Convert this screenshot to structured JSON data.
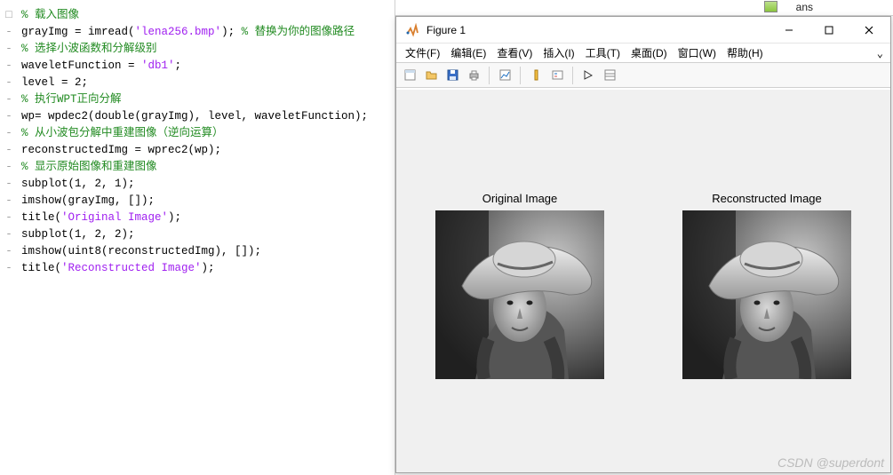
{
  "top_strip": {
    "box_label": "ans"
  },
  "code": {
    "lines": [
      {
        "dash": "□",
        "segs": [
          {
            "t": "% 载入图像",
            "c": "comment"
          }
        ]
      },
      {
        "dash": "-",
        "segs": [
          {
            "t": "grayImg = imread(",
            "c": "black"
          },
          {
            "t": "'lena256.bmp'",
            "c": "string"
          },
          {
            "t": "); ",
            "c": "black"
          },
          {
            "t": "% 替换为你的图像路径",
            "c": "comment"
          }
        ]
      },
      {
        "dash": "",
        "segs": []
      },
      {
        "dash": "",
        "segs": []
      },
      {
        "dash": "-",
        "segs": [
          {
            "t": "% 选择小波函数和分解级别",
            "c": "comment"
          }
        ]
      },
      {
        "dash": "-",
        "segs": [
          {
            "t": "waveletFunction = ",
            "c": "black"
          },
          {
            "t": "'db1'",
            "c": "string"
          },
          {
            "t": ";",
            "c": "black"
          }
        ]
      },
      {
        "dash": "-",
        "segs": [
          {
            "t": "level = 2;",
            "c": "black"
          }
        ]
      },
      {
        "dash": "",
        "segs": []
      },
      {
        "dash": "-",
        "segs": [
          {
            "t": "% 执行WPT正向分解",
            "c": "comment"
          }
        ]
      },
      {
        "dash": "-",
        "segs": [
          {
            "t": "wp= wpdec2(double(grayImg), level, waveletFunction);",
            "c": "black"
          }
        ]
      },
      {
        "dash": "",
        "segs": []
      },
      {
        "dash": "-",
        "segs": [
          {
            "t": "% 从小波包分解中重建图像（逆向运算）",
            "c": "comment"
          }
        ]
      },
      {
        "dash": "-",
        "segs": [
          {
            "t": "reconstructedImg = wprec2(wp);",
            "c": "black"
          }
        ]
      },
      {
        "dash": "",
        "segs": []
      },
      {
        "dash": "-",
        "segs": [
          {
            "t": "% 显示原始图像和重建图像",
            "c": "comment"
          }
        ]
      },
      {
        "dash": "-",
        "segs": [
          {
            "t": "subplot(1, 2, 1);",
            "c": "black"
          }
        ]
      },
      {
        "dash": "-",
        "segs": [
          {
            "t": "imshow(grayImg, []);",
            "c": "black"
          }
        ]
      },
      {
        "dash": "-",
        "segs": [
          {
            "t": "title(",
            "c": "black"
          },
          {
            "t": "'Original Image'",
            "c": "string"
          },
          {
            "t": ");",
            "c": "black"
          }
        ]
      },
      {
        "dash": "",
        "segs": []
      },
      {
        "dash": "-",
        "segs": [
          {
            "t": "subplot(1, 2, 2);",
            "c": "black"
          }
        ]
      },
      {
        "dash": "-",
        "segs": [
          {
            "t": "imshow(uint8(reconstructedImg), []);",
            "c": "black"
          }
        ]
      },
      {
        "dash": "-",
        "segs": [
          {
            "t": "title(",
            "c": "black"
          },
          {
            "t": "'Reconstructed Image'",
            "c": "string"
          },
          {
            "t": ");",
            "c": "black"
          }
        ]
      }
    ]
  },
  "figure": {
    "title": "Figure 1",
    "menus": [
      "文件(F)",
      "编辑(E)",
      "查看(V)",
      "插入(I)",
      "工具(T)",
      "桌面(D)",
      "窗口(W)",
      "帮助(H)"
    ],
    "expand": "⌄",
    "subplots": [
      {
        "title": "Original Image"
      },
      {
        "title": "Reconstructed Image"
      }
    ]
  },
  "watermark": "CSDN @superdont"
}
